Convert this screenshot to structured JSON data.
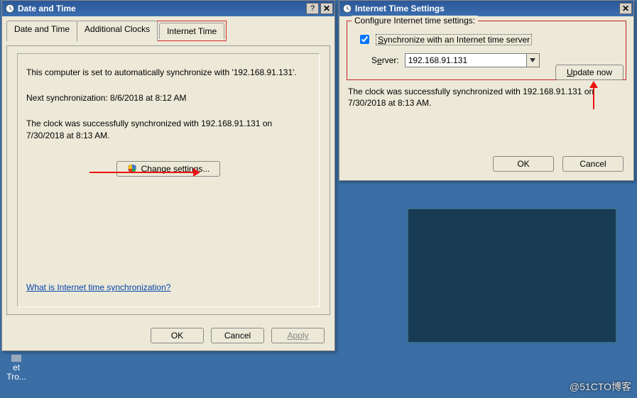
{
  "dt_window": {
    "title": "Date and Time",
    "tabs": [
      {
        "label": "Date and Time"
      },
      {
        "label": "Additional Clocks"
      },
      {
        "label": "Internet Time"
      }
    ],
    "line_sync": "This computer is set to automatically synchronize with '192.168.91.131'.",
    "line_next": "Next synchronization: 8/6/2018 at 8:12 AM",
    "line_last": "The clock was successfully synchronized with 192.168.91.131 on 7/30/2018 at 8:13 AM.",
    "change_settings_label": "Change settings...",
    "link_text": "What is Internet time synchronization?",
    "ok": "OK",
    "cancel": "Cancel",
    "apply": "Apply"
  },
  "its_window": {
    "title": "Internet Time Settings",
    "group_title": "Configure Internet time settings:",
    "checkbox_label": "Synchronize with an Internet time server",
    "checkbox_checked": true,
    "server_label": "Server:",
    "server_value": "192.168.91.131",
    "update_now": "Update now",
    "status": "The clock was successfully synchronized with 192.168.91.131 on 7/30/2018 at 8:13 AM.",
    "ok": "OK",
    "cancel": "Cancel"
  },
  "desktop_icon_label": "et\nTro...",
  "watermark": "@51CTO博客"
}
